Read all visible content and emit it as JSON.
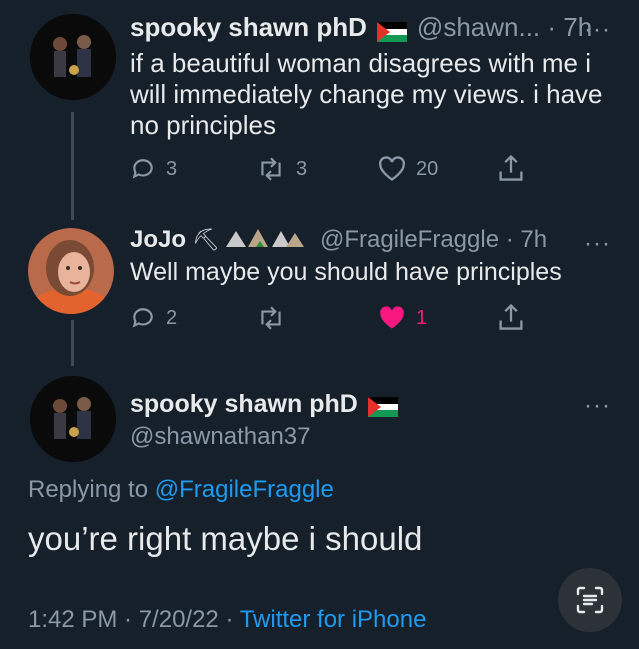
{
  "tweet1": {
    "name": "spooky shawn phD",
    "handle_time": "@shawn... · 7h",
    "more": "···",
    "text": "if a beautiful woman disagrees with me i will immediately change my views. i have no principles",
    "replies": "3",
    "retweets": "3",
    "likes": "20"
  },
  "tweet2": {
    "name": "JoJo",
    "handle_time": "@FragileFraggle · 7h",
    "more": "···",
    "text": "Well maybe you should have principles",
    "replies": "2",
    "retweets": "",
    "likes": "1"
  },
  "tweet3": {
    "name": "spooky shawn phD",
    "handle": "@shawnathan37",
    "more": "···",
    "replying_prefix": "Replying to",
    "replying_to": "@FragileFraggle",
    "text": "you’re right maybe i should",
    "time": "1:42 PM · 7/20/22 ·",
    "source": "Twitter for iPhone"
  },
  "colors": {
    "background": "#15202b",
    "secondary_text": "#8b98a5",
    "link": "#1d9bf0",
    "like": "#f91880"
  },
  "icons": [
    "reply-icon",
    "retweet-icon",
    "like-icon",
    "share-icon",
    "more-icon",
    "flag-icon",
    "scan-icon"
  ]
}
